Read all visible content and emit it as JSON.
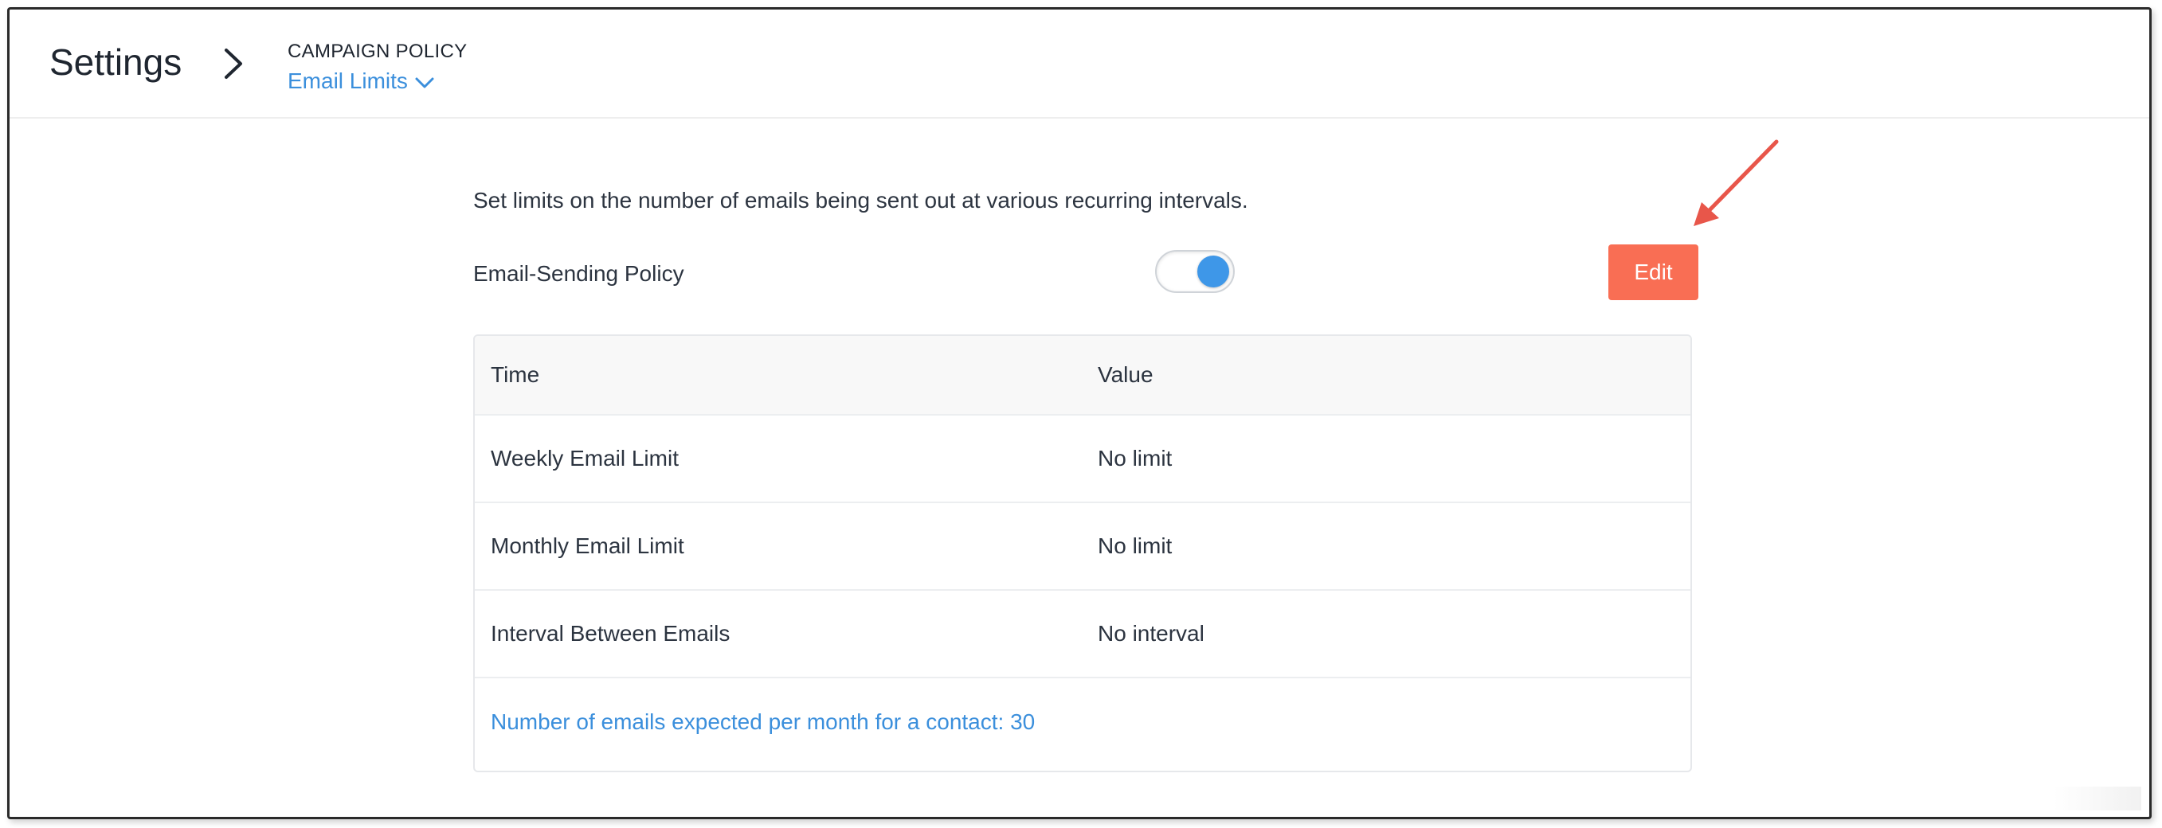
{
  "header": {
    "title": "Settings",
    "breadcrumb_section": "CAMPAIGN POLICY",
    "breadcrumb_current": "Email Limits"
  },
  "main": {
    "description": "Set limits on the number of emails being sent out at various recurring intervals.",
    "policy_toggle_label": "Email-Sending Policy",
    "policy_toggle_on": true,
    "edit_label": "Edit",
    "table": {
      "columns": [
        "Time",
        "Value"
      ],
      "rows": [
        {
          "time": "Weekly Email Limit",
          "value": "No limit"
        },
        {
          "time": "Monthly Email Limit",
          "value": "No limit"
        },
        {
          "time": "Interval Between Emails",
          "value": "No interval"
        }
      ],
      "footer_note": "Number of emails expected per month for a contact: 30"
    }
  },
  "icons": {
    "breadcrumb_separator": "chevron-right-icon",
    "dropdown": "chevron-down-icon"
  },
  "colors": {
    "accent_blue": "#3b8fdc",
    "toggle_knob": "#3e97e8",
    "edit_button": "#f96e54",
    "annotation_arrow": "#e8564a"
  }
}
